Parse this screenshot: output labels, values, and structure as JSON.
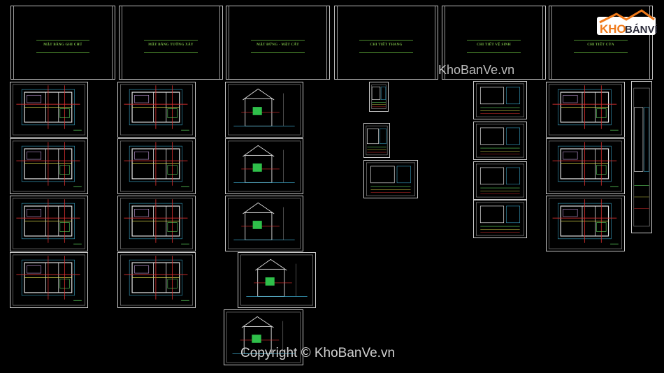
{
  "title_sheets": [
    {
      "label": "MẶT BẰNG GHI CHÚ"
    },
    {
      "label": "MẶT BẰNG TƯỜNG XÂY"
    },
    {
      "label": "MẶT ĐỨNG - MẶT CẮT"
    },
    {
      "label": "CHI TIẾT THANG"
    },
    {
      "label": "CHI TIẾT VỆ SINH"
    },
    {
      "label": "CHI TIẾT CỬA"
    }
  ],
  "watermarks": {
    "top": "KhoBanVe.vn",
    "bottom": "Copyright © KhoBanVe.vn"
  },
  "logo": {
    "text_left": "KHO",
    "text_right": "BÁNVẼ",
    "colors": {
      "orange": "#f07a1a",
      "dark": "#2b2b3a"
    }
  },
  "colors": {
    "background": "#000000",
    "title_text": "#7fc24a",
    "sheet_border": "#c8c8c8"
  }
}
